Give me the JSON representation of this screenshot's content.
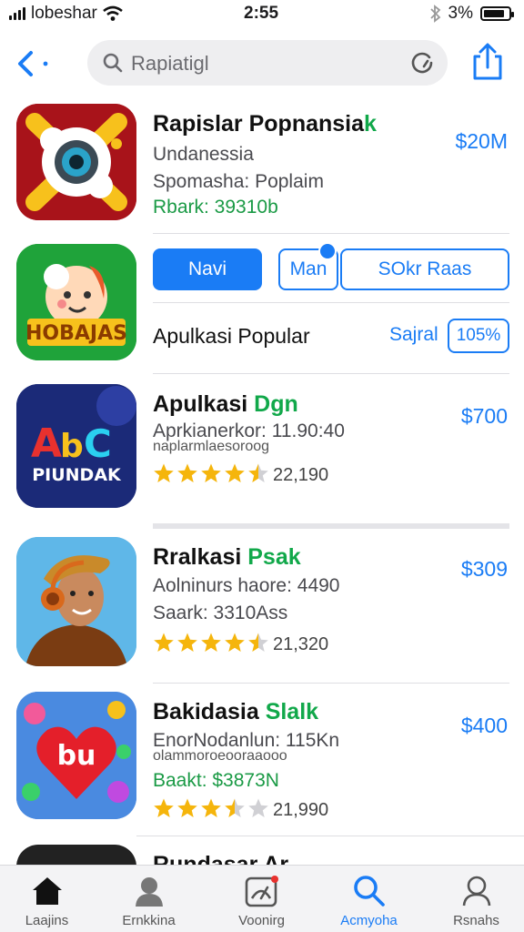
{
  "status_bar": {
    "carrier": "lobeshar",
    "time": "2:55",
    "battery": "3%",
    "battery_level": 0.85
  },
  "nav": {
    "search_text": "Rapiatigl",
    "back_icon": "chevron-left-icon",
    "refresh_icon": "refresh-icon",
    "share_icon": "share-icon"
  },
  "apps": [
    {
      "title_main": "Rapislar Popnansia",
      "title_accent": "k",
      "line1": "Undanessia",
      "line2": "Spomasha: Poplaim",
      "line3": "Rbark: 39310b",
      "price": "$20M"
    },
    {
      "buttons": {
        "navi": "Navi",
        "man": "Man",
        "sokr": "SOkr Raas"
      },
      "section_title": "Apulkasi Popular",
      "section_link": "Sajral",
      "section_badge": "105%"
    },
    {
      "title_main": "Apulkasi ",
      "title_accent": "Dgn",
      "line1": "Aprkianerkor: 11.90:40",
      "line2": "naplarmlaesoroog",
      "rating": 4.5,
      "rating_count": "22,190",
      "price": "$700"
    },
    {
      "title_main": "Rralkasi ",
      "title_accent": "Psak",
      "line1": "Aolninurs haore: 4490",
      "line2": "Saark: 3310Ass",
      "rating": 4.5,
      "rating_count": "21,320",
      "price": "$309"
    },
    {
      "title_main": "Bakidasia ",
      "title_accent": "Slalk",
      "line1": "EnorNodanlun: 115Kn",
      "line2": "olammoroeooraaooo",
      "line3": "Baakt: $3873N",
      "rating": 3.5,
      "rating_count": "21,990",
      "price": "$400"
    },
    {
      "title_main": "Rundasar Ar"
    }
  ],
  "tabs": [
    {
      "label": "Laajins",
      "icon": "home-icon",
      "active": false
    },
    {
      "label": "Ernkkina",
      "icon": "person-icon",
      "active": false
    },
    {
      "label": "Voonirg",
      "icon": "gauge-icon",
      "active": false
    },
    {
      "label": "Acmyoha",
      "icon": "search-icon",
      "active": true
    },
    {
      "label": "Rsnahs",
      "icon": "profile-icon",
      "active": false
    }
  ],
  "colors": {
    "accent": "#1a7cf5",
    "green": "#11a84a",
    "star": "#f5b50c"
  }
}
